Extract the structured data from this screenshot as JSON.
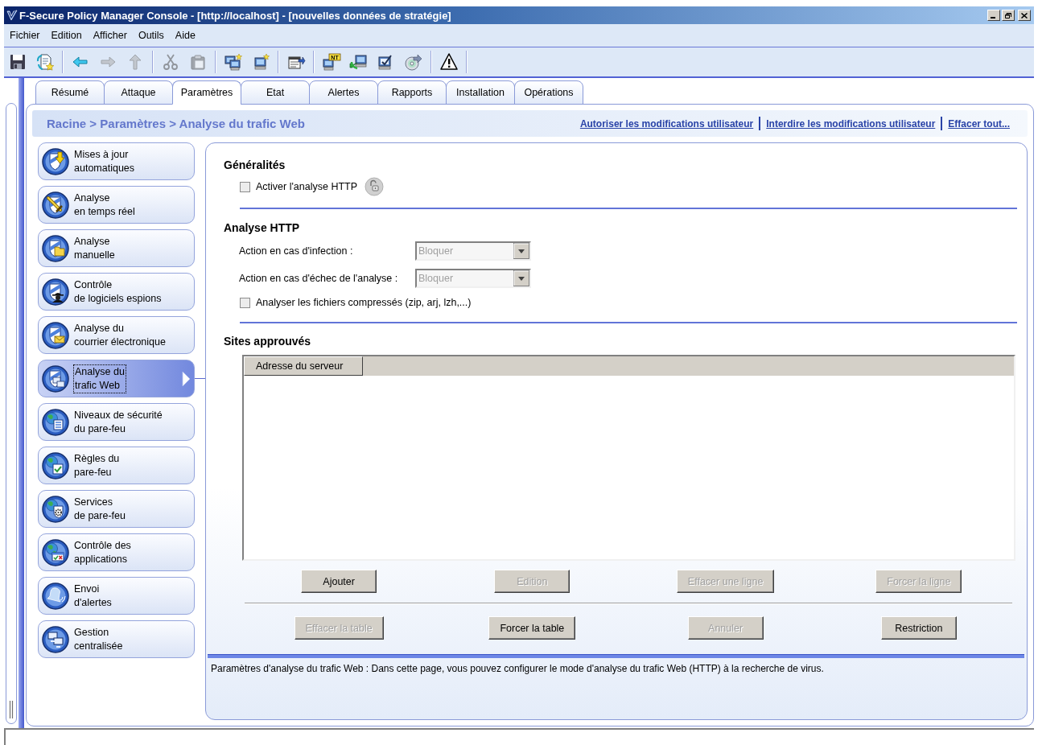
{
  "window": {
    "title": "F-Secure Policy Manager Console - [http://localhost] - [nouvelles données de stratégie]"
  },
  "menu": [
    "Fichier",
    "Edition",
    "Afficher",
    "Outils",
    "Aide"
  ],
  "toolbar": [
    [
      {
        "disabled": false
      },
      {
        "disabled": false
      }
    ],
    [
      {
        "disabled": false
      },
      {
        "disabled": true
      },
      {
        "disabled": true
      }
    ],
    [
      {
        "disabled": true
      },
      {
        "disabled": true
      }
    ],
    [
      {
        "disabled": false
      },
      {
        "disabled": false
      }
    ],
    [
      {
        "disabled": false
      }
    ],
    [
      {
        "disabled": false,
        "label": "NT"
      },
      {
        "disabled": false
      },
      {
        "disabled": false
      },
      {
        "disabled": false
      }
    ],
    [
      {
        "disabled": false
      }
    ]
  ],
  "tabs": [
    {
      "label": "Résumé",
      "selected": false
    },
    {
      "label": "Attaque",
      "selected": false
    },
    {
      "label": "Paramètres",
      "selected": true
    },
    {
      "label": "Etat",
      "selected": false
    },
    {
      "label": "Alertes",
      "selected": false
    },
    {
      "label": "Rapports",
      "selected": false
    },
    {
      "label": "Installation",
      "selected": false
    },
    {
      "label": "Opérations",
      "selected": false
    }
  ],
  "breadcrumb": "Racine > Paramètres > Analyse du trafic Web",
  "links": [
    "Autoriser les modifications utilisateur",
    "Interdire les modifications utilisateur",
    "Effacer tout..."
  ],
  "sidebar": {
    "items": [
      {
        "label": "Mises à jour\nautomatiques",
        "selected": false
      },
      {
        "label": "Analyse\nen temps réel",
        "selected": false
      },
      {
        "label": "Analyse\nmanuelle",
        "selected": false
      },
      {
        "label": "Contrôle\nde logiciels espions",
        "selected": false
      },
      {
        "label": "Analyse du\ncourrier électronique",
        "selected": false
      },
      {
        "label": "Analyse du\ntrafic Web",
        "selected": true
      },
      {
        "label": "Niveaux de sécurité\ndu pare-feu",
        "selected": false
      },
      {
        "label": "Règles du\npare-feu",
        "selected": false
      },
      {
        "label": "Services\nde pare-feu",
        "selected": false
      },
      {
        "label": "Contrôle des\napplications",
        "selected": false
      },
      {
        "label": "Envoi\nd'alertes",
        "selected": false
      },
      {
        "label": "Gestion\ncentralisée",
        "selected": false
      }
    ]
  },
  "general": {
    "title": "Généralités",
    "checkbox": {
      "label": "Activer l'analyse HTTP",
      "checked": false
    }
  },
  "http": {
    "title": "Analyse HTTP",
    "fields": [
      {
        "label": "Action en cas d'infection :",
        "value": "Bloquer",
        "disabled": true
      },
      {
        "label": "Action en cas d'échec de l'analyse :",
        "value": "Bloquer",
        "disabled": true
      }
    ],
    "checkbox": {
      "label": "Analyser les fichiers compressés (zip, arj, lzh,...)",
      "checked": false
    }
  },
  "sites": {
    "title": "Sites approuvés",
    "table": {
      "columns": [
        "Adresse du serveur"
      ]
    },
    "button_rows": [
      [
        {
          "label": "Ajouter",
          "disabled": false
        },
        {
          "label": "Edition",
          "disabled": true
        },
        {
          "label": "Effacer une ligne",
          "disabled": true
        },
        {
          "label": "Forcer la ligne",
          "disabled": true
        }
      ],
      [
        {
          "label": "Effacer la table",
          "disabled": true
        },
        {
          "label": "Forcer la table",
          "disabled": false
        },
        {
          "label": "Annuler",
          "disabled": true
        },
        {
          "label": "Restriction",
          "disabled": false
        }
      ]
    ]
  },
  "description": "Paramètres d'analyse du trafic Web : Dans cette page, vous pouvez configurer le mode d'analyse du trafic Web (HTTP) à la recherche de virus."
}
